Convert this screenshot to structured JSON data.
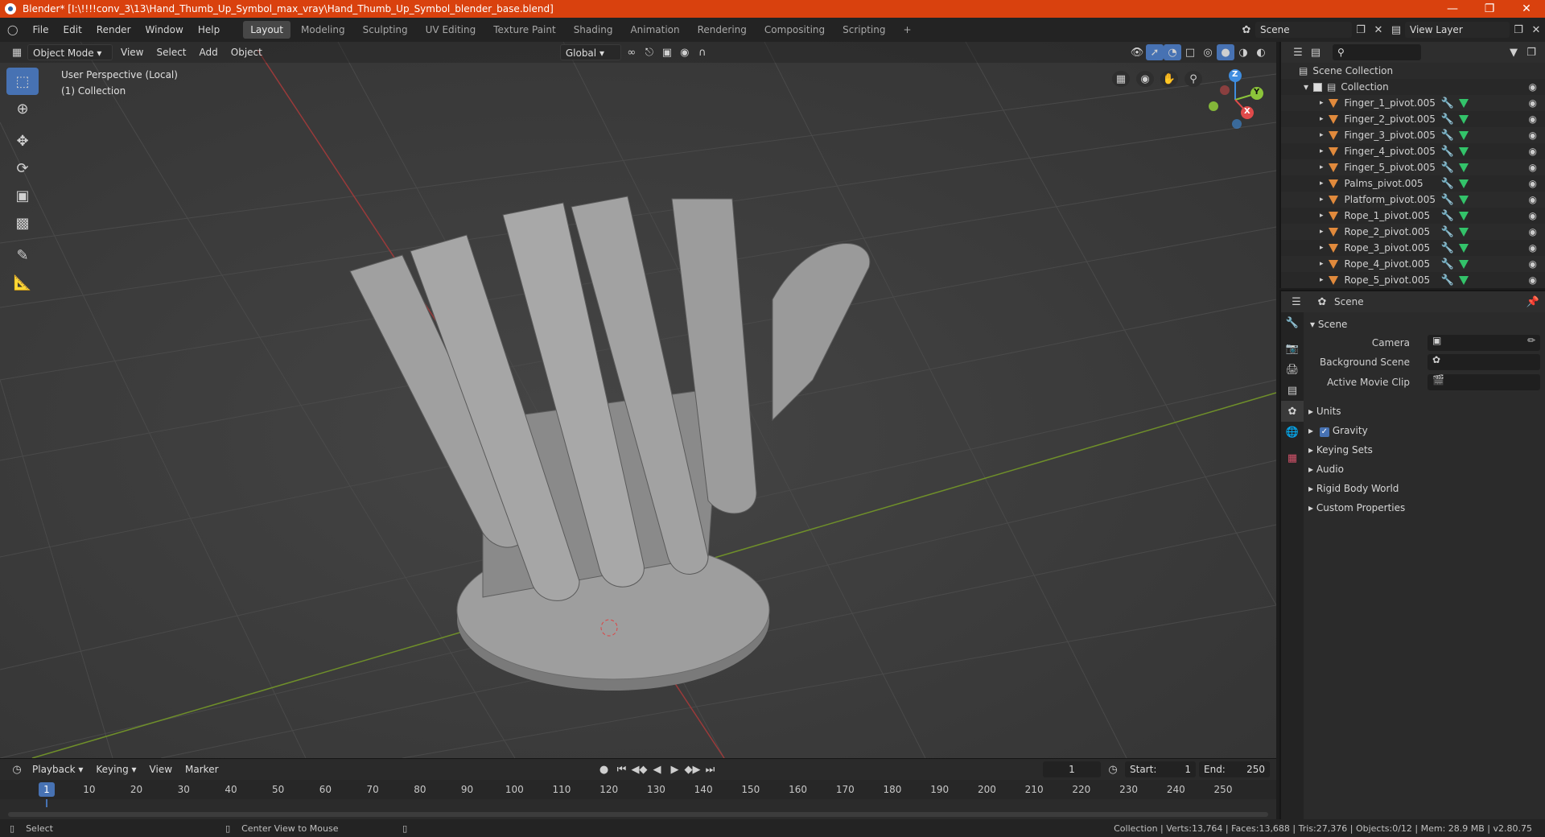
{
  "window": {
    "title": "Blender* [I:\\!!!!conv_3\\13\\Hand_Thumb_Up_Symbol_max_vray\\Hand_Thumb_Up_Symbol_blender_base.blend]"
  },
  "menubar": {
    "menus": [
      "File",
      "Edit",
      "Render",
      "Window",
      "Help"
    ],
    "workspaces": [
      "Layout",
      "Modeling",
      "Sculpting",
      "UV Editing",
      "Texture Paint",
      "Shading",
      "Animation",
      "Rendering",
      "Compositing",
      "Scripting"
    ],
    "active_workspace": "Layout",
    "add_tab": "+",
    "scene_name": "Scene",
    "view_layer": "View Layer"
  },
  "viewport": {
    "mode": "Object Mode",
    "menus": [
      "View",
      "Select",
      "Add",
      "Object"
    ],
    "transform_orientation": "Global",
    "perspective_label": "User Perspective (Local)",
    "collection_label": "(1) Collection",
    "gizmo_axes": {
      "x": "X",
      "y": "Y",
      "z": "Z"
    },
    "colors": {
      "x_axis": "#e04a4a",
      "y_axis": "#8cc43a",
      "z_axis": "#3e8de0"
    }
  },
  "timeline": {
    "menus": [
      "Playback",
      "Keying",
      "View",
      "Marker"
    ],
    "current_frame": "1",
    "start_label": "Start:",
    "start": "1",
    "end_label": "End:",
    "end": "250",
    "ticks": [
      "1",
      "10",
      "20",
      "30",
      "40",
      "50",
      "60",
      "70",
      "80",
      "90",
      "100",
      "110",
      "120",
      "130",
      "140",
      "150",
      "160",
      "170",
      "180",
      "190",
      "200",
      "210",
      "220",
      "230",
      "240",
      "250"
    ]
  },
  "statusbar": {
    "left_action": "Select",
    "middle_action": "Center View to Mouse",
    "stats": "Collection | Verts:13,764 | Faces:13,688 | Tris:27,376 | Objects:0/12 | Mem: 28.9 MB | v2.80.75"
  },
  "outliner": {
    "scene_collection": "Scene Collection",
    "collection": "Collection",
    "objects": [
      "Finger_1_pivot.005",
      "Finger_2_pivot.005",
      "Finger_3_pivot.005",
      "Finger_4_pivot.005",
      "Finger_5_pivot.005",
      "Palms_pivot.005",
      "Platform_pivot.005",
      "Rope_1_pivot.005",
      "Rope_2_pivot.005",
      "Rope_3_pivot.005",
      "Rope_4_pivot.005",
      "Rope_5_pivot.005"
    ]
  },
  "properties": {
    "header": "Scene",
    "panel_title": "Scene",
    "camera_label": "Camera",
    "background_scene_label": "Background Scene",
    "active_movie_clip_label": "Active Movie Clip",
    "sections": [
      "Units",
      "Gravity",
      "Keying Sets",
      "Audio",
      "Rigid Body World",
      "Custom Properties"
    ],
    "gravity_checked": true
  }
}
